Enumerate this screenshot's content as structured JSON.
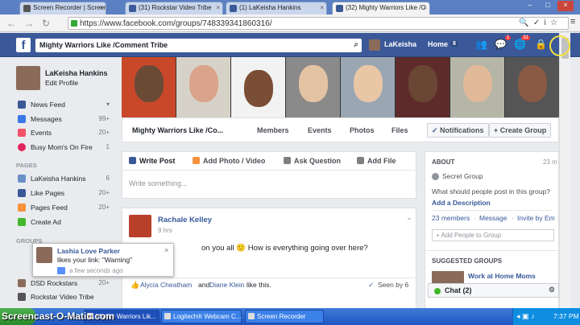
{
  "browser": {
    "tabs": [
      {
        "label": "Screen Recorder | Screenca",
        "active": false
      },
      {
        "label": "(31) Rockstar Video Tribe",
        "active": false
      },
      {
        "label": "(1) LaKeisha Hankins",
        "active": false
      },
      {
        "label": "(32) Mighty Warriors Like /C",
        "active": true
      }
    ],
    "url": "https://www.facebook.com/groups/748339341860316/"
  },
  "header": {
    "search_value": "Mighty Warriors Like /Comment Tribe",
    "user_name": "LaKeisha",
    "home_label": "Home",
    "home_count": "8",
    "messages_badge": "1",
    "notifications_badge": "31"
  },
  "profile": {
    "name": "LaKeisha Hankins",
    "edit": "Edit Profile"
  },
  "left_nav": {
    "items": [
      {
        "label": "News Feed",
        "count": "",
        "color": "#3b5998"
      },
      {
        "label": "Messages",
        "count": "99+",
        "color": "#3b78e7"
      },
      {
        "label": "Events",
        "count": "20+",
        "color": "#f35369"
      },
      {
        "label": "Busy Mom's On Fire",
        "count": "1",
        "color": "#e0245e"
      }
    ],
    "pages_heading": "PAGES",
    "pages": [
      {
        "label": "LaKeisha Hankins",
        "count": "6",
        "color": "#6b8fc9"
      },
      {
        "label": "Like Pages",
        "count": "20+",
        "color": "#3b5998"
      },
      {
        "label": "Pages Feed",
        "count": "20+",
        "color": "#f7923a"
      },
      {
        "label": "Create Ad",
        "count": "",
        "color": "#42b72a"
      }
    ],
    "groups_heading": "GROUPS",
    "groups": [
      {
        "label": "DSD Rockstars",
        "count": "20+"
      },
      {
        "label": "Rockstar Video Tribe",
        "count": ""
      }
    ]
  },
  "group": {
    "name": "Mighty Warriors Like /Co...",
    "tabs": [
      "Members",
      "Events",
      "Photos",
      "Files"
    ],
    "notifications_label": "Notifications",
    "create_group_label": "Create Group"
  },
  "composer": {
    "tabs": [
      "Write Post",
      "Add Photo / Video",
      "Ask Question",
      "Add File"
    ],
    "placeholder": "Write something..."
  },
  "post": {
    "author": "Rachale Kelley",
    "time": "9 hrs",
    "text": "on you all 🙂 How is everything going over here?",
    "likers_1": "Alycia Cheatham",
    "and": "and",
    "likers_2": "Diane Klein",
    "like_suffix": "like this.",
    "seen_by": "Seen by 6"
  },
  "notification": {
    "name": "Lashia Love Parker",
    "text": "likes your link: \"Warning\"",
    "time": "a few seconds ago"
  },
  "about": {
    "heading": "ABOUT",
    "members_short": "23 m",
    "secret": "Secret Group",
    "question": "What should people post in this group?",
    "add_desc": "Add a Description",
    "members": "23 members",
    "message": "Message",
    "invite": "Invite by Em",
    "add_people_placeholder": "+ Add People to Group",
    "suggested_heading": "SUGGESTED GROUPS",
    "suggested_name": "Work at Home Moms"
  },
  "chat": {
    "label": "Chat (2)"
  },
  "taskbar": {
    "watermark": "Screencast-O-Matic.com",
    "tasks": [
      "Mighty Warriors Lik...",
      "Logitech® Webcam C...",
      "Screen Recorder"
    ],
    "time": "7:37 PM"
  },
  "colors": {
    "facebook_blue": "#3b5998",
    "link": "#365899"
  }
}
